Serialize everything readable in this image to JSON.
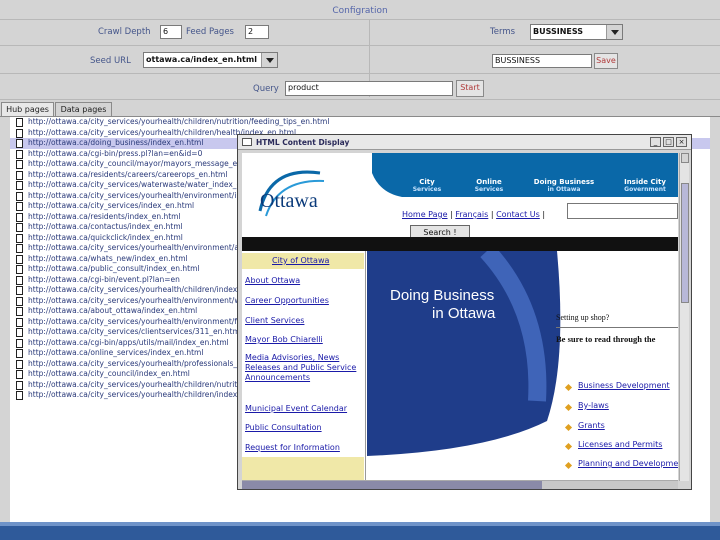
{
  "config": {
    "title": "Configration",
    "crawl_depth_label": "Crawl Depth",
    "crawl_depth_value": "6",
    "feed_pages_label": "Feed Pages",
    "feed_pages_value": "2",
    "terms_label": "Terms",
    "terms_value": "BUSSINESS",
    "seed_url_label": "Seed URL",
    "seed_url_value": "ottawa.ca/index_en.html",
    "term_input_value": "BUSSINESS",
    "save_label": "Save",
    "query_label": "Query",
    "query_value": "product",
    "start_label": "Start"
  },
  "tabs": [
    {
      "label": "Hub pages",
      "active": true
    },
    {
      "label": "Data pages",
      "active": false
    }
  ],
  "urls": [
    "http://ottawa.ca/city_services/yourhealth/children/nutrition/feeding_tips_en.html",
    "http://ottawa.ca/city_services/yourhealth/children/health/index_en.html",
    "http://ottawa.ca/doing_business/index_en.html",
    "http://ottawa.ca/cgi-bin/press.pl?lan=en&id=0",
    "http://ottawa.ca/city_council/mayor/mayors_message_en.html",
    "http://ottawa.ca/residents/careers/careerops_en.html",
    "http://ottawa.ca/city_services/waterwaste/water_index_en.html",
    "http://ottawa.ca/city_services/yourhealth/environment/index_en.html",
    "http://ottawa.ca/city_services/index_en.html",
    "http://ottawa.ca/residents/index_en.html",
    "http://ottawa.ca/contactus/index_en.html",
    "http://ottawa.ca/quickclick/index_en.html",
    "http://ottawa.ca/city_services/yourhealth/environment/air_en.html",
    "http://ottawa.ca/whats_new/index_en.html",
    "http://ottawa.ca/public_consult/index_en.html",
    "http://ottawa.ca/cgi-bin/event.pl?lan=en",
    "http://ottawa.ca/city_services/yourhealth/children/index_en.html",
    "http://ottawa.ca/city_services/yourhealth/environment/water_en.html",
    "http://ottawa.ca/about_ottawa/index_en.html",
    "http://ottawa.ca/city_services/yourhealth/environment/food_en.html",
    "http://ottawa.ca/city_services/clientservices/311_en.html",
    "http://ottawa.ca/cgi-bin/apps/utils/mail/index_en.html",
    "http://ottawa.ca/online_services/index_en.html",
    "http://ottawa.ca/city_services/yourhealth/professionals_en.html",
    "http://ottawa.ca/city_council/index_en.html",
    "http://ottawa.ca/city_services/yourhealth/children/nutrition/feeding_tips_en.html",
    "http://ottawa.ca/city_services/yourhealth/children/index_en.html"
  ],
  "selected_index": 2,
  "popup": {
    "title": "HTML Content Display",
    "logo_text": "Ottawa",
    "nav": [
      {
        "main": "City",
        "sub": "Services"
      },
      {
        "main": "Online",
        "sub": "Services"
      },
      {
        "main": "Doing Business",
        "sub": "in Ottawa"
      },
      {
        "main": "Inside City",
        "sub": "Government"
      }
    ],
    "top_links": [
      "Home Page",
      "Français",
      "Contact Us"
    ],
    "search_label": "Search !",
    "sidebar_links": [
      "City of Ottawa",
      "About Ottawa",
      "Career Opportunities",
      "Client Services",
      "Mayor Bob Chiarelli",
      "Media Advisories, News Releases and Public Service Announcements",
      "Municipal Event Calendar",
      "Public Consultation",
      "Request for Information"
    ],
    "banner_line1": "Doing Business",
    "banner_line2": "in Ottawa",
    "setting_up": "Setting up shop?",
    "be_sure": "Be sure to read through the",
    "bullets": [
      "Business Development",
      "By-laws",
      "Grants",
      "Licenses and Permits",
      "Planning and Development"
    ]
  },
  "colors": {
    "accent": "#2f5a9a",
    "nav_blue": "#0a68a8",
    "banner_blue": "#1f3d8a",
    "save_red": "#b03a3a"
  }
}
